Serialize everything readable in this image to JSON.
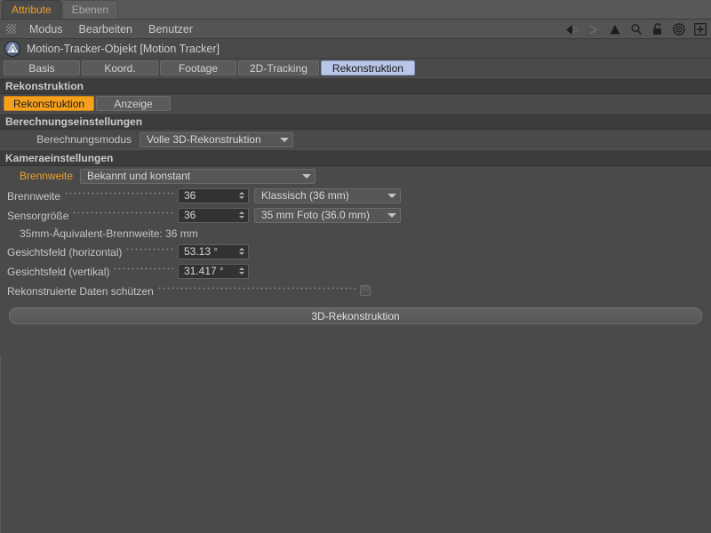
{
  "panel_tabs": [
    {
      "label": "Attribute",
      "active": true
    },
    {
      "label": "Ebenen",
      "active": false
    }
  ],
  "menu": {
    "grip_icon": "grip-dots-icon",
    "items": [
      "Modus",
      "Bearbeiten",
      "Benutzer"
    ],
    "icons": [
      "back-arrow-icon",
      "forward-arrow-icon",
      "up-arrow-icon",
      "search-icon",
      "lock-open-icon",
      "target-icon",
      "plus-icon"
    ]
  },
  "object": {
    "icon": "motion-tracker-object-icon",
    "title": "Motion-Tracker-Objekt [Motion Tracker]"
  },
  "object_tabs": [
    {
      "label": "Basis",
      "selected": false
    },
    {
      "label": "Koord.",
      "selected": false
    },
    {
      "label": "Footage",
      "selected": false
    },
    {
      "label": "2D-Tracking",
      "selected": false
    },
    {
      "label": "Rekonstruktion",
      "selected": true
    }
  ],
  "groups": {
    "reconstruction": "Rekonstruktion",
    "calc_settings": "Berechnungseinstellungen",
    "camera_settings": "Kameraeinstellungen"
  },
  "sub_tabs": [
    {
      "label": "Rekonstruktion",
      "selected": true
    },
    {
      "label": "Anzeige",
      "selected": false
    }
  ],
  "fields": {
    "calc_mode": {
      "label": "Berechnungsmodus",
      "value": "Volle 3D-Rekonstruktion"
    },
    "focal_mode": {
      "label": "Brennweite",
      "value": "Bekannt und konstant",
      "accent": true
    },
    "focal_length": {
      "label": "Brennweite",
      "value": "36",
      "preset": "Klassisch (36 mm)"
    },
    "sensor_size": {
      "label": "Sensorgröße",
      "value": "36",
      "preset": "35 mm Foto (36.0 mm)"
    },
    "equiv_focal": {
      "text": "35mm-Äquivalent-Brennweite: 36 mm"
    },
    "fov_h": {
      "label": "Gesichtsfeld (horizontal)",
      "value": "53.13 °"
    },
    "fov_v": {
      "label": "Gesichtsfeld (vertikal)",
      "value": "31.417 °"
    },
    "protect_data": {
      "label": "Rekonstruierte Daten schützen",
      "checked": false
    }
  },
  "action_button": {
    "label": "3D-Rekonstruktion"
  },
  "colors": {
    "accent_orange": "#f0a029",
    "tab_orange": "#f5a11e",
    "selected_tab_blue": "#b9c6e8",
    "panel_bg": "#4a4a4a",
    "group_header_bg": "#3c3c3c",
    "field_bg": "#323232"
  }
}
